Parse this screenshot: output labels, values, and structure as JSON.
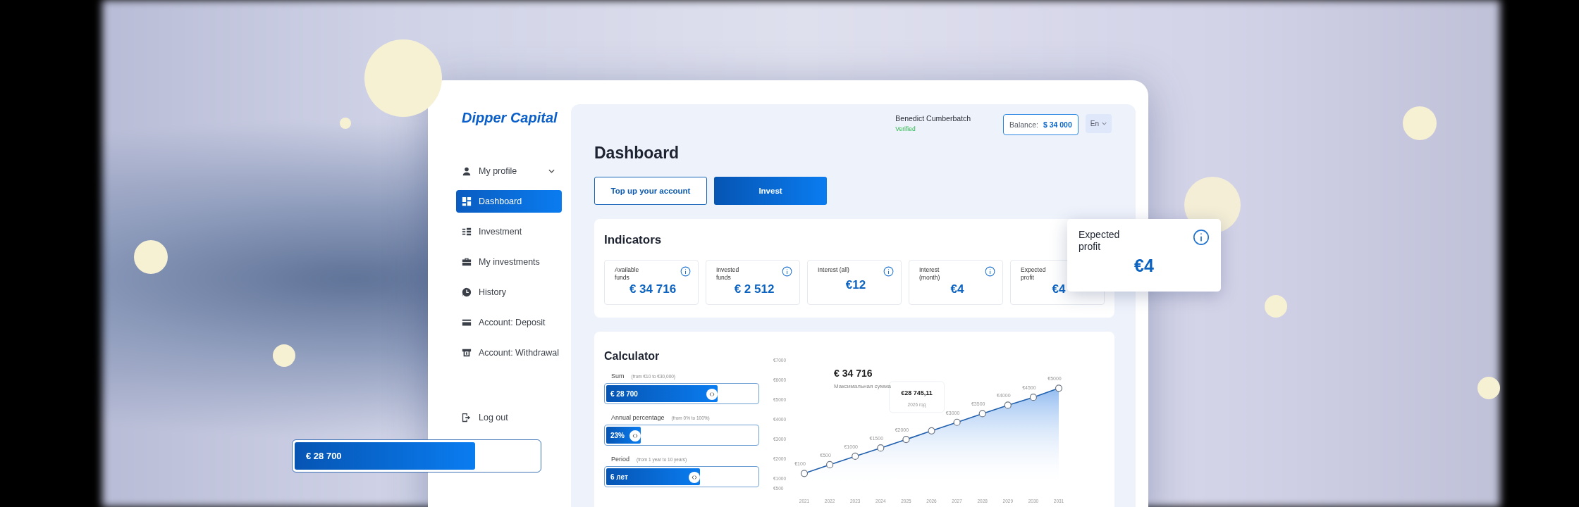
{
  "sidebar": {
    "logo": "Dipper Capital",
    "items": [
      {
        "kind": "profile",
        "label": "My profile",
        "selected": false,
        "expandable": true
      },
      {
        "kind": "dashboard",
        "label": "Dashboard",
        "selected": true
      },
      {
        "kind": "investment",
        "label": "Investment",
        "selected": false
      },
      {
        "kind": "portfolio",
        "label": "My investments",
        "selected": false
      },
      {
        "kind": "history",
        "label": "History",
        "selected": false
      },
      {
        "kind": "deposit",
        "label": "Account: Deposit",
        "selected": false
      },
      {
        "kind": "withdrawal",
        "label": "Account: Withdrawal",
        "selected": false
      }
    ],
    "logout": "Log out"
  },
  "header": {
    "user_name": "Benedict Cumberbatch",
    "status": "Verified",
    "balance_label": "Balance:",
    "balance_value": "$ 34 000",
    "language": "En"
  },
  "page_title": "Dashboard",
  "actions": [
    {
      "kind": "outline",
      "label": "Top up your account"
    },
    {
      "kind": "primary",
      "label": "Invest"
    }
  ],
  "indicators": {
    "title": "Indicators",
    "cards": [
      {
        "label": "Available funds",
        "value": "€ 34 716"
      },
      {
        "label": "Invested funds",
        "value": "€ 2 512"
      },
      {
        "label": "Interest (all)",
        "value": "€12"
      },
      {
        "label": "Interest (month)",
        "value": "€4"
      },
      {
        "label": "Expected profit",
        "value": "€4"
      }
    ]
  },
  "calculator": {
    "title": "Calculator",
    "sliders": [
      {
        "label": "Sum",
        "range": "(from €10 to €30,000)",
        "value": "€ 28 700",
        "level": 0.74
      },
      {
        "label": "Annual percentage",
        "range": "(from 0% to 100%)",
        "value": "23%",
        "level": 0.23
      },
      {
        "label": "Period",
        "range": "(from 1 year to 10 years)",
        "value": "6 лет",
        "level": 0.62
      }
    ],
    "chart_total": "€ 34 716",
    "chart_caption": "Максимальная сумма",
    "chart_data": {
      "type": "area",
      "x": [
        "2021",
        "2022",
        "2023",
        "2024",
        "2025",
        "2026",
        "2027",
        "2028",
        "2029",
        "2030",
        "2031"
      ],
      "series": [
        {
          "color": "#1f5fae",
          "values": [
            1240,
            1680,
            2110,
            2530,
            2960,
            3400,
            3830,
            4270,
            4700,
            5100,
            5560
          ]
        }
      ],
      "ylim": [
        500,
        7000
      ],
      "yticks": [
        {
          "value": 500,
          "label": "€500"
        },
        {
          "value": 1000,
          "label": "€1000"
        },
        {
          "value": 2000,
          "label": "€2000"
        },
        {
          "value": 3000,
          "label": "€3000"
        },
        {
          "value": 4000,
          "label": "€4000"
        },
        {
          "value": 5000,
          "label": "€5000"
        },
        {
          "value": 6000,
          "label": "€6000"
        },
        {
          "value": 7000,
          "label": "€7000"
        }
      ],
      "value_labels": [
        "€100",
        "€500",
        "€1000",
        "€1500",
        "€2000",
        null,
        "€3000",
        "€3500",
        "€4000",
        "€4500",
        "€5000"
      ],
      "annotations": [
        "€28 745,11"
      ]
    },
    "tooltip_year": "2026 год"
  },
  "floating_card": {
    "label": "Expected profit",
    "value": "€4"
  },
  "floating_slider": {
    "value": "€ 28 700",
    "level": 0.74
  }
}
